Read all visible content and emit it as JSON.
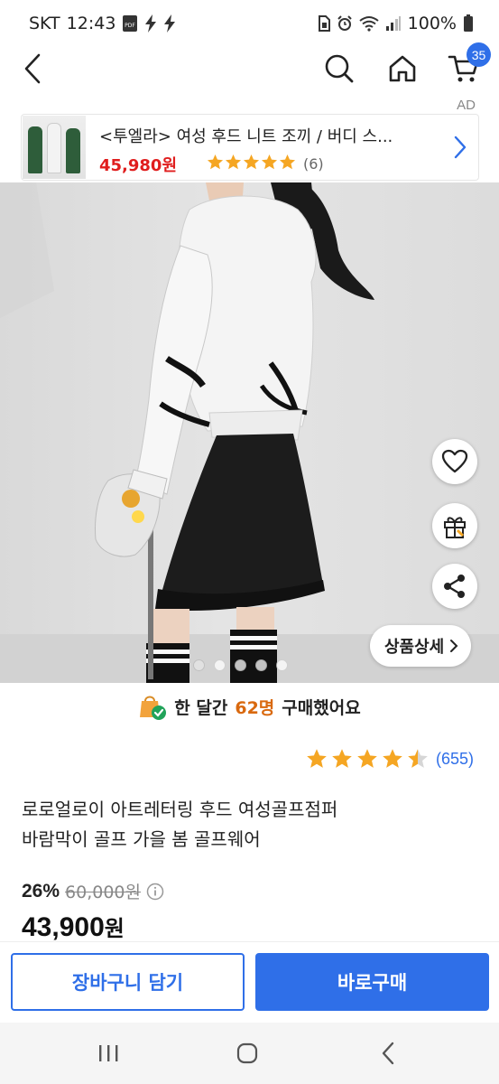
{
  "status_bar": {
    "carrier": "SKT",
    "time": "12:43",
    "battery": "100%"
  },
  "header": {
    "cart_count": "35",
    "ad_label": "AD"
  },
  "ad": {
    "title": "<투엘라> 여성 후드 니트 조끼 / 버디 스...",
    "price": "45,980원",
    "rating": 5,
    "review_count": "(6)"
  },
  "hero": {
    "detail_button": "상품상세",
    "image_count": 5,
    "active_index": 0
  },
  "purchase_notice": {
    "prefix": "한 달간",
    "count": "62명",
    "suffix": "구매했어요"
  },
  "product": {
    "rating": 4.5,
    "review_count": "(655)",
    "title_line1": "로로얼로이 아트레터링 후드 여성골프점퍼",
    "title_line2": "바람막이 골프 가을 봄 골프웨어",
    "discount_rate": "26%",
    "original_price": "60,000원",
    "price": "43,900",
    "price_unit": "원"
  },
  "actions": {
    "cart_label": "장바구니 담기",
    "buy_label": "바로구매"
  },
  "colors": {
    "accent": "#2f6fe8",
    "sale_red": "#e01e1e",
    "star": "#f5a623",
    "highlight": "#d9690f"
  }
}
